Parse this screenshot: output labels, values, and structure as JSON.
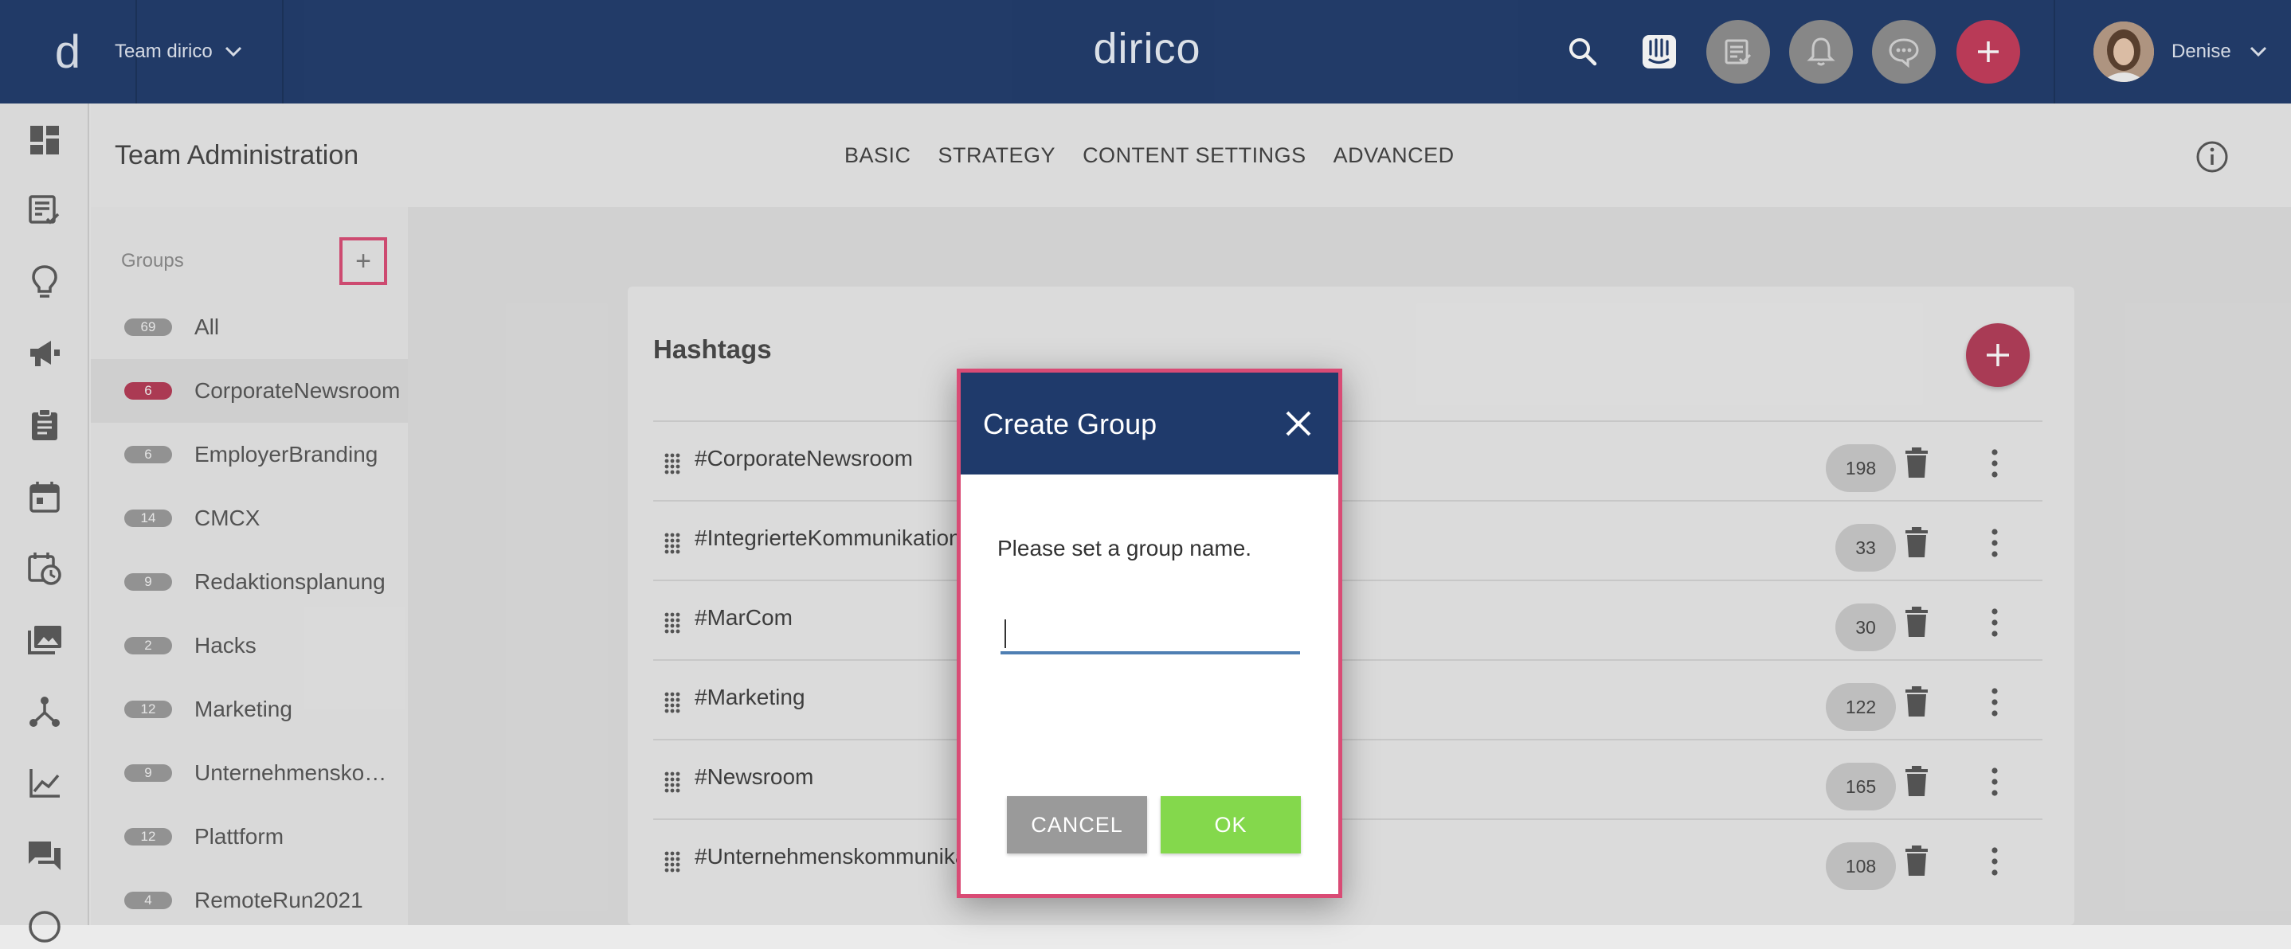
{
  "topbar": {
    "logo_letter": "d",
    "team_name": "Team dirico",
    "brand": "dirico",
    "user_name": "Denise"
  },
  "page": {
    "title": "Team Administration",
    "tabs": [
      "BASIC",
      "STRATEGY",
      "CONTENT SETTINGS",
      "ADVANCED"
    ]
  },
  "groups": {
    "label": "Groups",
    "add_label": "+",
    "items": [
      {
        "count": "69",
        "name": "All"
      },
      {
        "count": "6",
        "name": "CorporateNewsroom"
      },
      {
        "count": "6",
        "name": "EmployerBranding"
      },
      {
        "count": "14",
        "name": "CMCX"
      },
      {
        "count": "9",
        "name": "Redaktionsplanung"
      },
      {
        "count": "2",
        "name": "Hacks"
      },
      {
        "count": "12",
        "name": "Marketing"
      },
      {
        "count": "9",
        "name": "Unternehmenskommunikation"
      },
      {
        "count": "12",
        "name": "Plattform"
      },
      {
        "count": "4",
        "name": "RemoteRun2021"
      }
    ]
  },
  "hashtags": {
    "title": "Hashtags",
    "rows": [
      {
        "name": "#CorporateNewsroom",
        "count": "198"
      },
      {
        "name": "#IntegrierteKommunikation",
        "count": "33"
      },
      {
        "name": "#MarCom",
        "count": "30"
      },
      {
        "name": "#Marketing",
        "count": "122"
      },
      {
        "name": "#Newsroom",
        "count": "165"
      },
      {
        "name": "#Unternehmenskommunikation",
        "count": "108"
      }
    ]
  },
  "modal": {
    "title": "Create Group",
    "message": "Please set a group name.",
    "input_value": "",
    "cancel_label": "CANCEL",
    "ok_label": "OK"
  },
  "colors": {
    "navy": "#1f3a6b",
    "accent_pink": "#d94b75",
    "fab_red": "#b23b57",
    "ok_green": "#84d84c",
    "cancel_grey": "#9a9a9a"
  }
}
